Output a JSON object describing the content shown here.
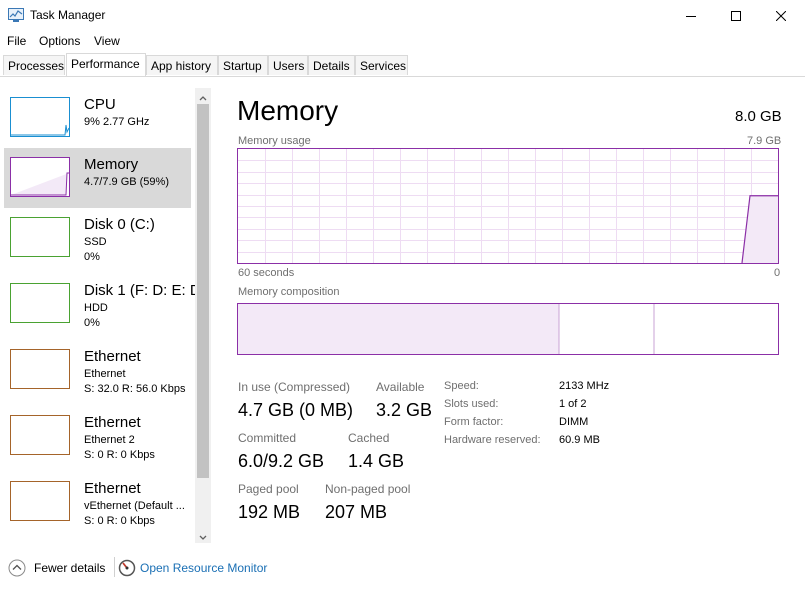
{
  "window": {
    "title": "Task Manager"
  },
  "menu": [
    "File",
    "Options",
    "View"
  ],
  "tabs": [
    "Processes",
    "Performance",
    "App history",
    "Startup",
    "Users",
    "Details",
    "Services"
  ],
  "devices": [
    {
      "name": "CPU",
      "line1": "9% 2.77 GHz",
      "line2": "",
      "color": "#1a8fd1"
    },
    {
      "name": "Memory",
      "line1": "4.7/7.9 GB (59%)",
      "line2": "",
      "color": "#8b2fa7"
    },
    {
      "name": "Disk 0 (C:)",
      "line1": "SSD",
      "line2": "0%",
      "color": "#4aa232"
    },
    {
      "name": "Disk 1 (F: D: E: D",
      "line1": "HDD",
      "line2": "0%",
      "color": "#4aa232"
    },
    {
      "name": "Ethernet",
      "line1": "Ethernet",
      "line2": "S: 32.0 R: 56.0 Kbps",
      "color": "#a5642a"
    },
    {
      "name": "Ethernet",
      "line1": "Ethernet 2",
      "line2": "S: 0 R: 0 Kbps",
      "color": "#a5642a"
    },
    {
      "name": "Ethernet",
      "line1": "vEthernet (Default ...",
      "line2": "S: 0 R: 0 Kbps",
      "color": "#a5642a"
    }
  ],
  "memory": {
    "title": "Memory",
    "total": "8.0 GB",
    "usage_label": "Memory usage",
    "usage_max": "7.9 GB",
    "time_left": "60 seconds",
    "time_right": "0",
    "composition_label": "Memory composition",
    "usage_level": 0.59,
    "stats": {
      "in_use_label": "In use (Compressed)",
      "in_use": "4.7 GB (0 MB)",
      "available_label": "Available",
      "available": "3.2 GB",
      "committed_label": "Committed",
      "committed": "6.0/9.2 GB",
      "cached_label": "Cached",
      "cached": "1.4 GB",
      "paged_label": "Paged pool",
      "paged": "192 MB",
      "nonpaged_label": "Non-paged pool",
      "nonpaged": "207 MB"
    },
    "details": {
      "speed_label": "Speed:",
      "speed": "2133 MHz",
      "slots_label": "Slots used:",
      "slots": "1 of 2",
      "form_label": "Form factor:",
      "form": "DIMM",
      "hwres_label": "Hardware reserved:",
      "hwres": "60.9 MB"
    }
  },
  "footer": {
    "fewer": "Fewer details",
    "resource_monitor": "Open Resource Monitor"
  },
  "colors": {
    "memory": "#8b2fa7",
    "link": "#1a6fb4",
    "selected": "#d9d9d9"
  }
}
